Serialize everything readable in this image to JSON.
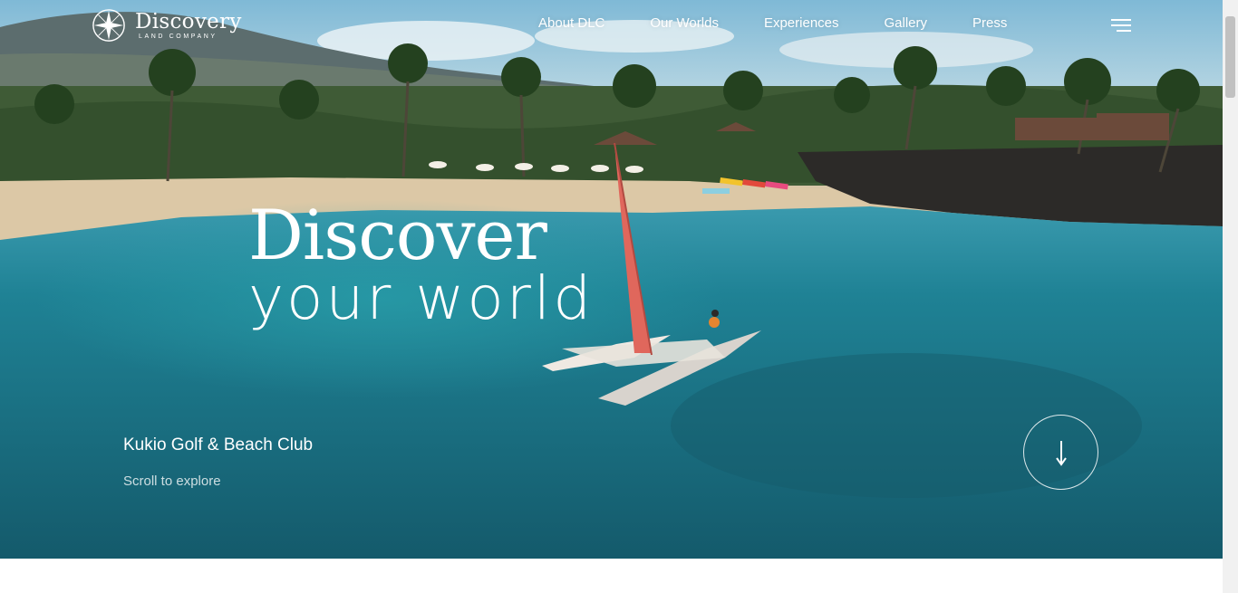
{
  "brand": {
    "name": "Discovery",
    "subtitle": "LAND COMPANY"
  },
  "nav": {
    "items": [
      {
        "label": "About DLC"
      },
      {
        "label": "Our Worlds"
      },
      {
        "label": "Experiences"
      },
      {
        "label": "Gallery"
      },
      {
        "label": "Press"
      }
    ],
    "menu_icon": "hamburger-icon"
  },
  "hero": {
    "headline_line1": "Discover",
    "headline_line2": "your world",
    "location": "Kukio Golf & Beach Club",
    "scroll_hint": "Scroll to explore",
    "scroll_icon": "arrow-down-icon"
  },
  "colors": {
    "text": "#ffffff",
    "water": "#1b6f83",
    "sand": "#d9c5a3",
    "sail": "#e0675c"
  }
}
